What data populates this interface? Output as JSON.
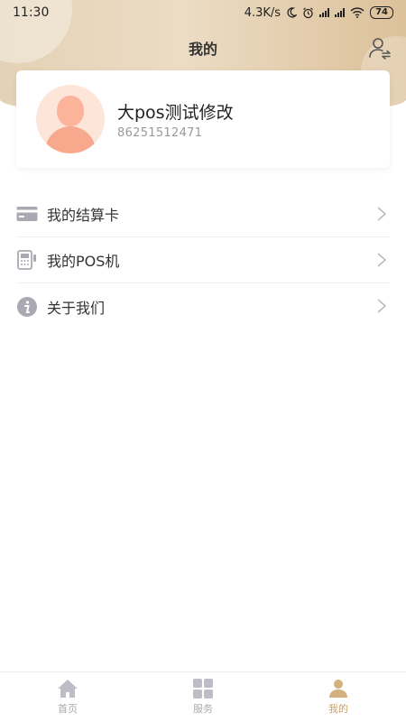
{
  "status_bar": {
    "time": "11:30",
    "net_speed": "4.3K/s",
    "battery": "74"
  },
  "header": {
    "title": "我的",
    "right_icon": "switch-user-icon"
  },
  "profile": {
    "name": "大pos测试修改",
    "id": "86251512471",
    "avatar_icon": "user-avatar-placeholder"
  },
  "menu": {
    "items": [
      {
        "label": "我的结算卡",
        "icon": "bank-card-icon"
      },
      {
        "label": "我的POS机",
        "icon": "pos-terminal-icon"
      },
      {
        "label": "关于我们",
        "icon": "info-icon"
      }
    ]
  },
  "tabbar": {
    "tabs": [
      {
        "label": "首页",
        "icon": "home-icon",
        "active": false
      },
      {
        "label": "服务",
        "icon": "grid-icon",
        "active": false
      },
      {
        "label": "我的",
        "icon": "user-icon",
        "active": true
      }
    ]
  },
  "colors": {
    "header_gradient_start": "#e4d2b6",
    "header_gradient_end": "#dcc19a",
    "active_tab": "#c9a06a",
    "inactive_tab": "#aaaaaa",
    "icon_gray": "#a9a9b4"
  }
}
